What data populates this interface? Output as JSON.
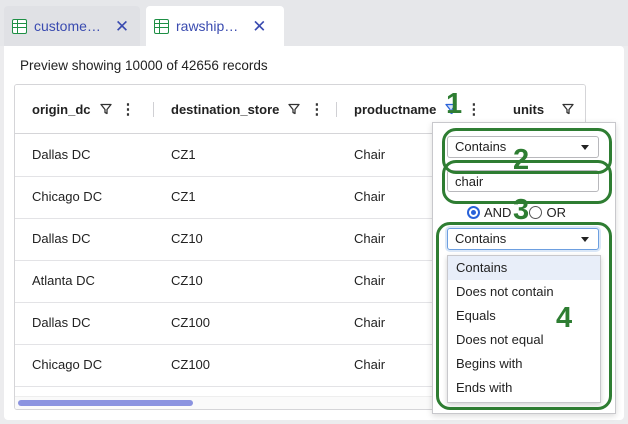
{
  "tabs": [
    {
      "label": "custome…",
      "icon": "spreadsheet-icon",
      "active": false
    },
    {
      "label": "rawship…",
      "icon": "spreadsheet-icon",
      "active": true
    }
  ],
  "preview_text": "Preview showing 10000 of 42656 records",
  "columns": [
    "origin_dc",
    "destination_store",
    "productname",
    "units"
  ],
  "rows": [
    [
      "Dallas DC",
      "CZ1",
      "Chair"
    ],
    [
      "Chicago DC",
      "CZ1",
      "Chair"
    ],
    [
      "Dallas DC",
      "CZ10",
      "Chair"
    ],
    [
      "Atlanta DC",
      "CZ10",
      "Chair"
    ],
    [
      "Dallas DC",
      "CZ100",
      "Chair"
    ],
    [
      "Chicago DC",
      "CZ100",
      "Chair"
    ]
  ],
  "filter": {
    "condition1": "Contains",
    "value1": "chair",
    "operator_and": "AND",
    "operator_or": "OR",
    "selected_operator": "AND",
    "condition2": "Contains",
    "options": [
      "Contains",
      "Does not contain",
      "Equals",
      "Does not equal",
      "Begins with",
      "Ends with"
    ]
  },
  "annotations": [
    "1",
    "2",
    "3",
    "4"
  ],
  "colors": {
    "annotation": "#2e7d32",
    "accent": "#3a4bb0",
    "scrollbar": "#8b93e0",
    "active_filter": "#2962d9"
  }
}
